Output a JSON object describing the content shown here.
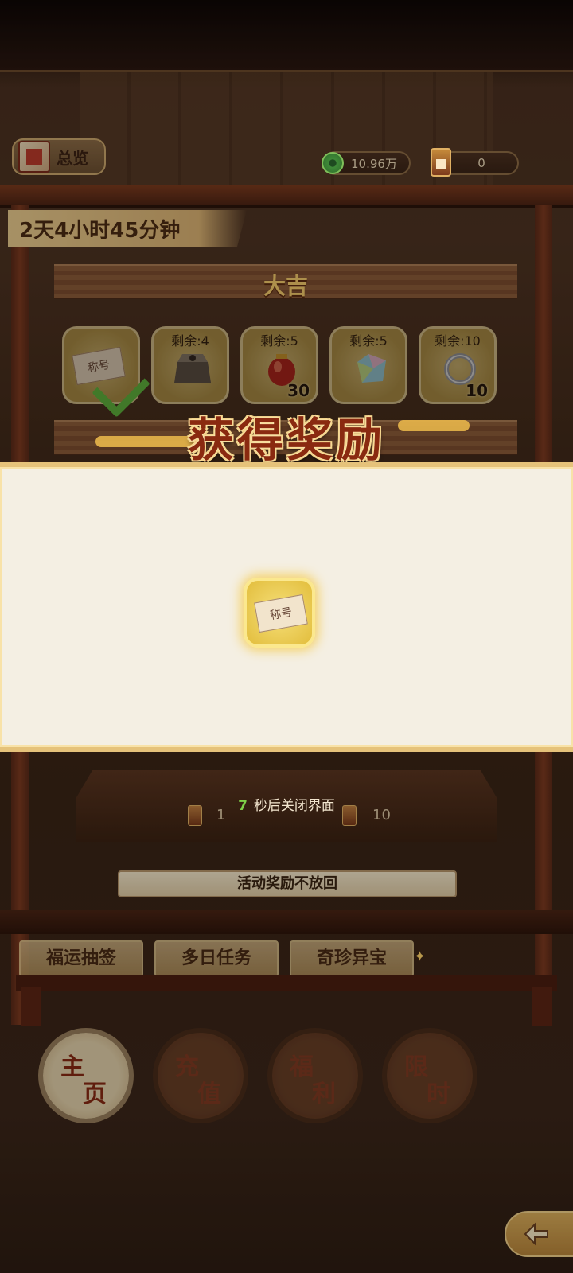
{
  "header": {
    "overview_label": "总览",
    "coins": "10.96万",
    "tickets": "0"
  },
  "timer": "2天4小时45分钟",
  "tier_title": "大吉",
  "prizes": [
    {
      "remaining": "",
      "count": "",
      "icon": "title-card-icon",
      "claimed": true
    },
    {
      "remaining": "剩余:4",
      "count": "",
      "icon": "stone-block-icon"
    },
    {
      "remaining": "剩余:5",
      "count": "30",
      "icon": "red-pouch-icon"
    },
    {
      "remaining": "剩余:5",
      "count": "",
      "icon": "crystal-icon"
    },
    {
      "remaining": "剩余:10",
      "count": "10",
      "icon": "silver-ring-icon"
    }
  ],
  "reward_modal": {
    "title": "获得奖励",
    "item_label": "称号",
    "countdown": "7",
    "close_hint": "秒后关闭界面"
  },
  "table_counts": [
    "1",
    "10"
  ],
  "notice": "活动奖励不放回",
  "tabs": [
    "福运抽签",
    "多日任务",
    "奇珍异宝"
  ],
  "nav": [
    {
      "c1": "主",
      "c2": "页",
      "active": true
    },
    {
      "c1": "充",
      "c2": "值"
    },
    {
      "c1": "福",
      "c2": "利"
    },
    {
      "c1": "限",
      "c2": "时"
    }
  ],
  "colors": {
    "accent_gold": "#e5c27a",
    "title_red": "#8a2a10",
    "countdown_green": "#7ed048"
  }
}
